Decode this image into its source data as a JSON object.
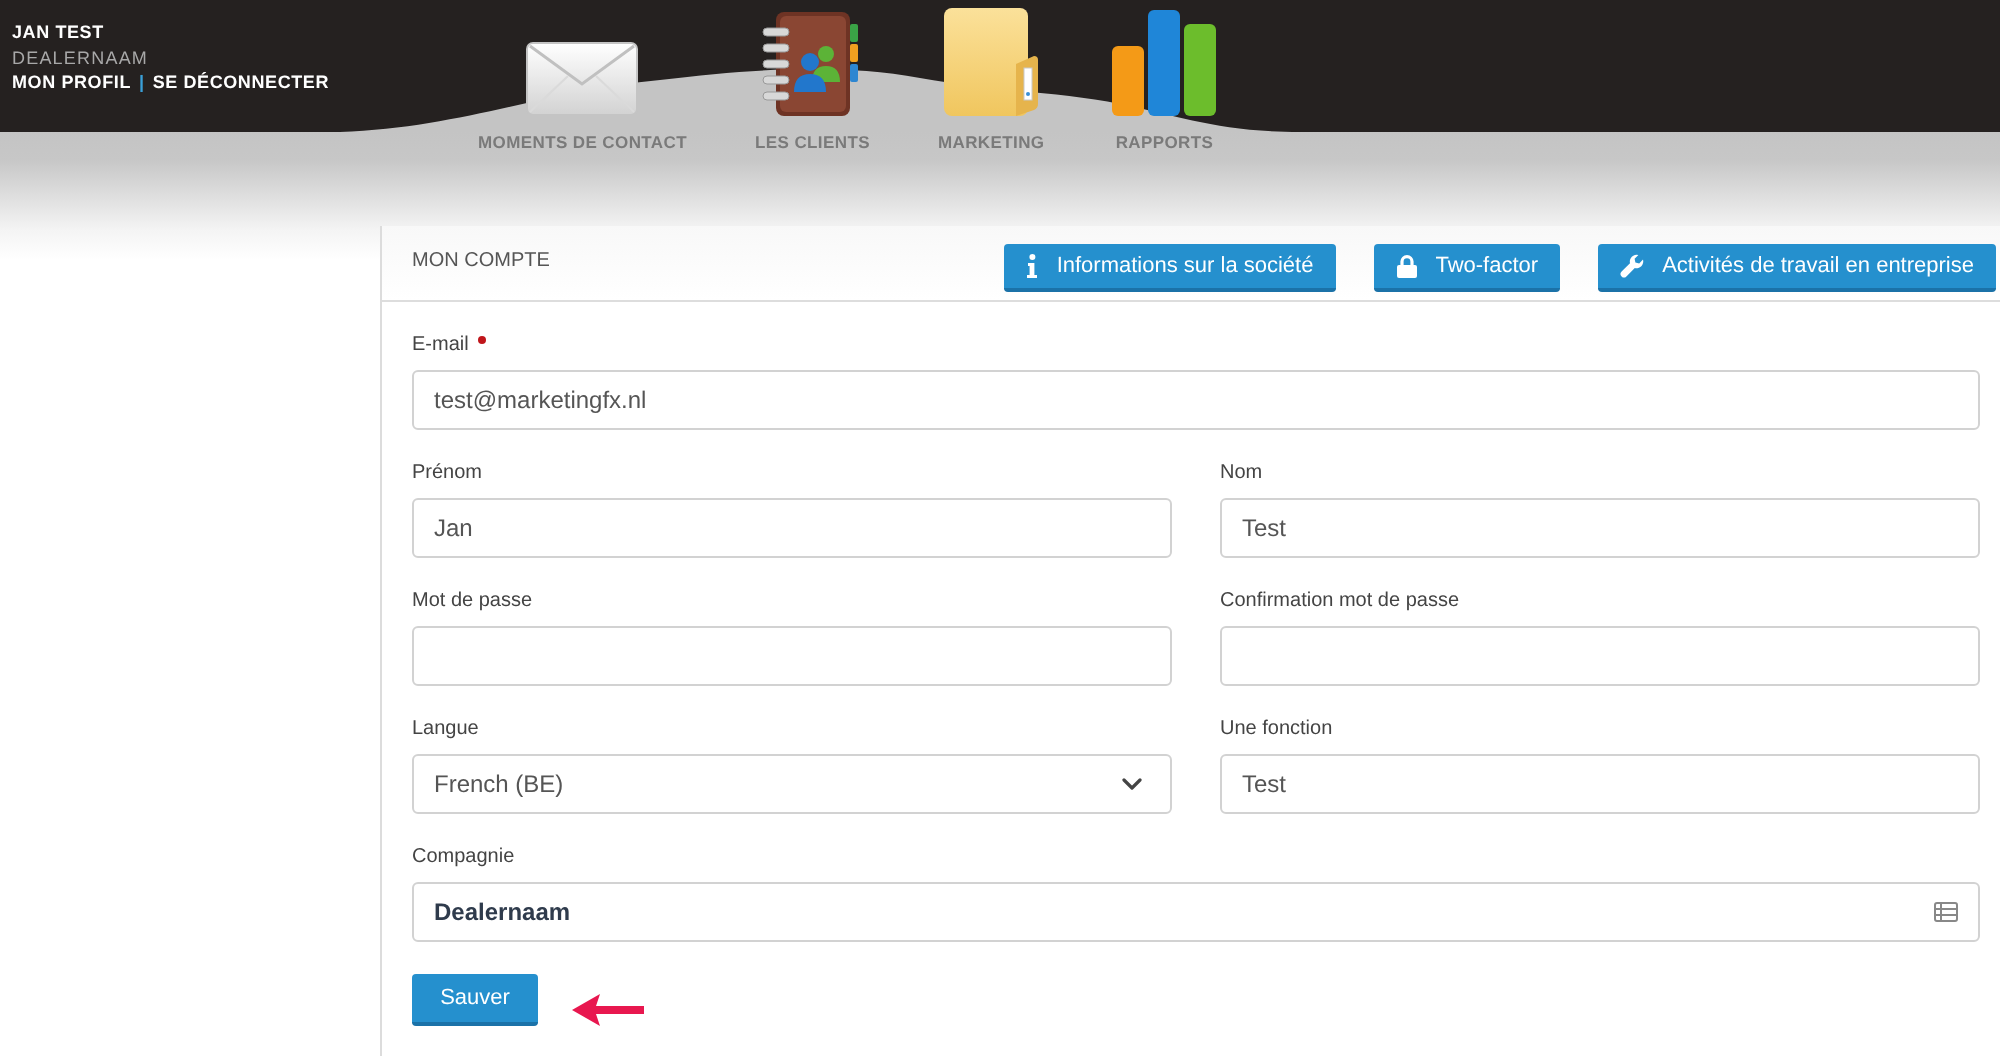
{
  "header": {
    "user_name": "JAN TEST",
    "dealer_name": "DEALERNAAM",
    "links": [
      {
        "label": "MON PROFIL"
      },
      {
        "label": "SE DÉCONNECTER"
      }
    ],
    "separator": "|"
  },
  "nav": [
    {
      "label": "MOMENTS DE CONTACT",
      "kind": "envelope"
    },
    {
      "label": "LES CLIENTS",
      "kind": "address-book"
    },
    {
      "label": "MARKETING",
      "kind": "folder"
    },
    {
      "label": "RAPPORTS",
      "kind": "bar-chart"
    }
  ],
  "panel": {
    "title": "MON COMPTE",
    "actions": [
      {
        "label": "Informations sur la société",
        "kind": "info"
      },
      {
        "label": "Two-factor",
        "kind": "lock"
      },
      {
        "label": "Activités de travail en entreprise",
        "kind": "wrench"
      }
    ]
  },
  "form": {
    "rows": [
      {
        "fields": [
          {
            "label": "E-mail",
            "required": true,
            "kind": "text",
            "value": "test@marketingfx.nl"
          }
        ]
      },
      {
        "fields": [
          {
            "label": "Prénom",
            "required": false,
            "kind": "text",
            "value": "Jan"
          },
          {
            "label": "Nom",
            "required": false,
            "kind": "text",
            "value": "Test"
          }
        ]
      },
      {
        "fields": [
          {
            "label": "Mot de passe",
            "required": false,
            "kind": "password"
          },
          {
            "label": "Confirmation mot de passe",
            "required": false,
            "kind": "password"
          }
        ]
      },
      {
        "fields": [
          {
            "label": "Langue",
            "required": false,
            "kind": "select",
            "value": "French (BE)"
          },
          {
            "label": "Une fonction",
            "required": false,
            "kind": "text",
            "value": "Test"
          }
        ]
      },
      {
        "fields": [
          {
            "label": "Compagnie",
            "required": false,
            "kind": "lookup",
            "value": "Dealernaam"
          }
        ]
      }
    ],
    "save_button": {
      "label": "Sauver",
      "pointer_arrow": true
    }
  }
}
